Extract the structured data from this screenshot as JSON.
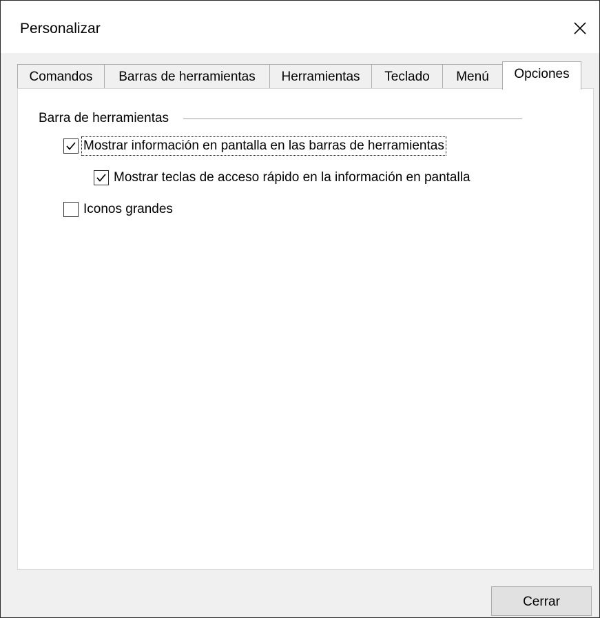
{
  "window": {
    "title": "Personalizar"
  },
  "tabs": [
    {
      "label": "Comandos",
      "active": false
    },
    {
      "label": "Barras de herramientas",
      "active": false
    },
    {
      "label": "Herramientas",
      "active": false
    },
    {
      "label": "Teclado",
      "active": false
    },
    {
      "label": "Menú",
      "active": false
    },
    {
      "label": "Opciones",
      "active": true
    }
  ],
  "options": {
    "group_label": "Barra de herramientas",
    "checkboxes": [
      {
        "label": "Mostrar información en pantalla en las barras de herramientas",
        "checked": true,
        "focused": true
      },
      {
        "label": "Mostrar teclas de acceso rápido en la información en pantalla",
        "checked": true,
        "focused": false
      },
      {
        "label": "Iconos grandes",
        "checked": false,
        "focused": false
      }
    ]
  },
  "footer": {
    "close_label": "Cerrar"
  },
  "icons": {
    "close": "close-icon",
    "check": "checkmark-icon"
  },
  "colors": {
    "dialog_bg": "#f0f0f0",
    "panel_bg": "#ffffff",
    "border": "#adadad"
  }
}
